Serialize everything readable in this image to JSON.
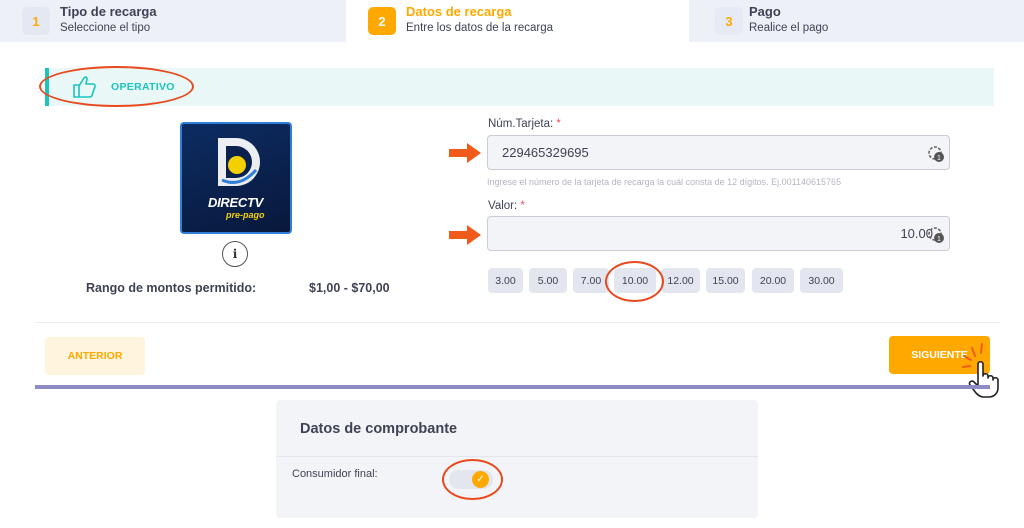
{
  "stepper": {
    "steps": [
      {
        "num": "1",
        "title": "Tipo de recarga",
        "subtitle": "Seleccione el tipo"
      },
      {
        "num": "2",
        "title": "Datos de recarga",
        "subtitle": "Entre los datos de la recarga"
      },
      {
        "num": "3",
        "title": "Pago",
        "subtitle": "Realice el pago"
      }
    ],
    "active_index": 1
  },
  "status": {
    "label": "OPERATIVO",
    "icon": "thumbs-up-icon",
    "color": "#1bc5bd"
  },
  "product": {
    "logo_text": "DIRECTV",
    "logo_sub": "pre-pago",
    "range_label": "Rango de montos permitido:",
    "range_value": "$1,00 - $70,00"
  },
  "form": {
    "card_label": "Núm.Tarjeta:",
    "card_required": "*",
    "card_value": "229465329695",
    "card_hint": "Ingrese el número de la tarjeta de recarga la cuál consta de 12 dígitos. Ej.001140615765",
    "amount_label": "Valor:",
    "amount_required": "*",
    "amount_value": "10.00",
    "amounts": [
      "3.00",
      "5.00",
      "7.00",
      "10.00",
      "12.00",
      "15.00",
      "20.00",
      "30.00"
    ],
    "selected_amount": "10.00"
  },
  "nav": {
    "prev_label": "ANTERIOR",
    "next_label": "SIGUIENTE"
  },
  "receipt": {
    "title": "Datos de comprobante",
    "consumer_label": "Consumidor final:",
    "consumer_checked": true
  },
  "colors": {
    "accent": "#ffa800",
    "success": "#1bc5bd",
    "annotation": "#e8491d"
  }
}
